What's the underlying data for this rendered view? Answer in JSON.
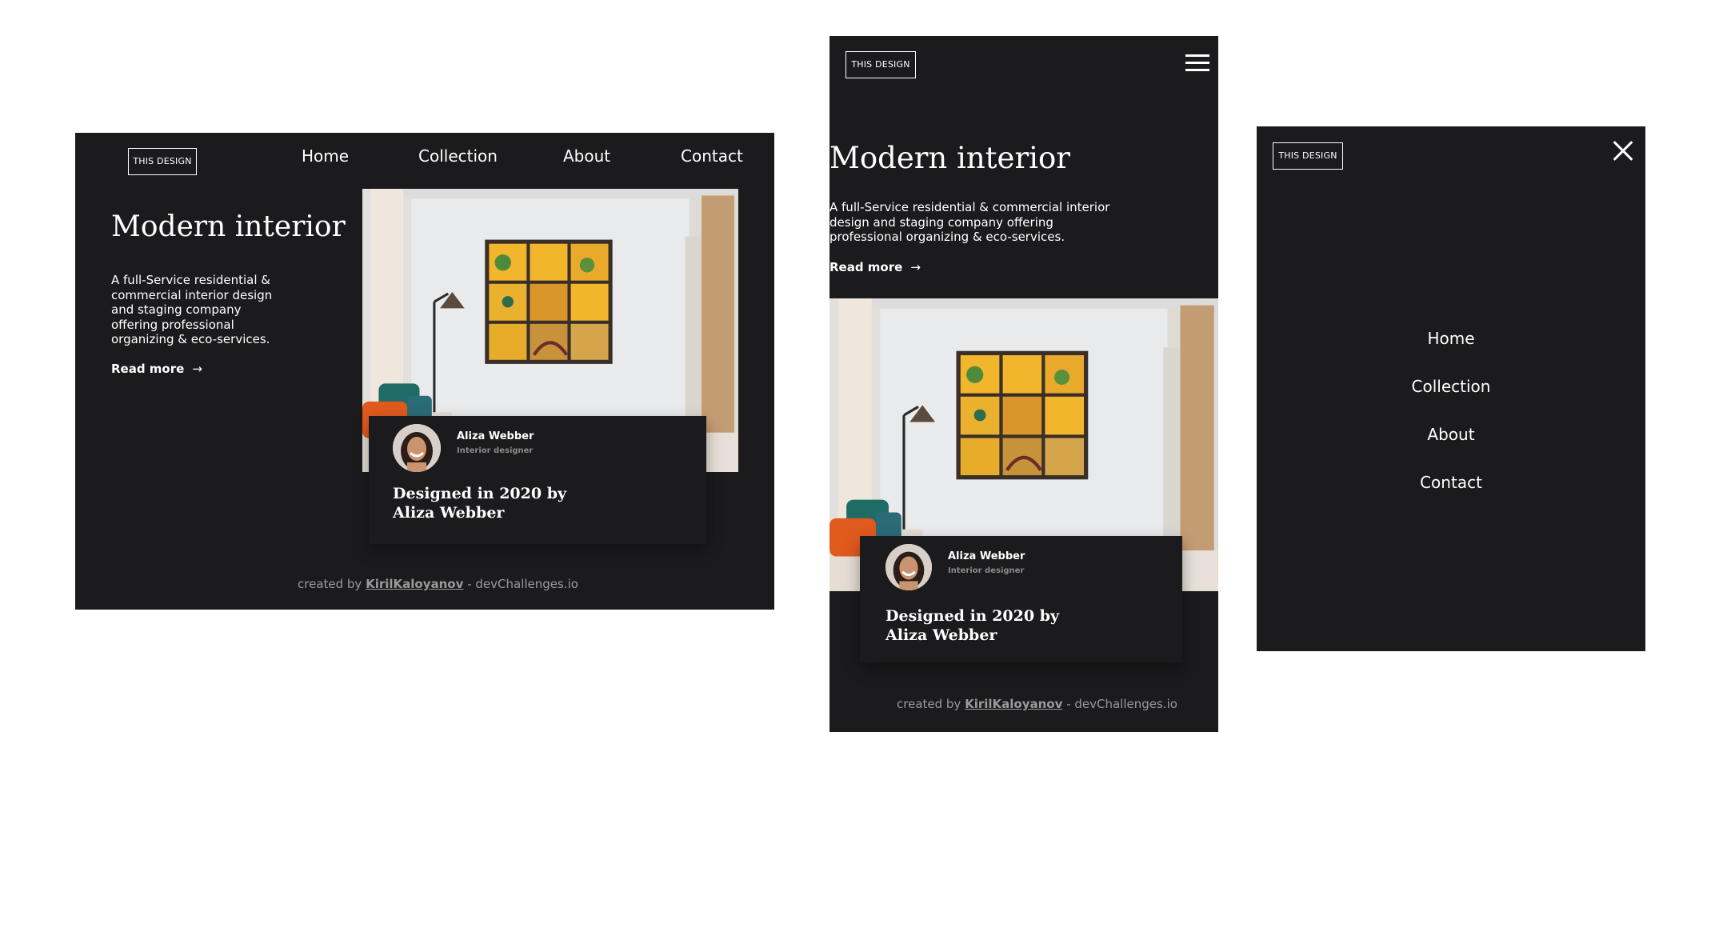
{
  "brand": {
    "logo": "THIS DESIGN"
  },
  "nav": {
    "items": [
      "Home",
      "Collection",
      "About",
      "Contact"
    ]
  },
  "hero": {
    "title": "Modern interior",
    "description": "A full-Service residential & commercial interior design and staging company offering professional organizing & eco-services.",
    "read_more": "Read more",
    "arrow": "→"
  },
  "card": {
    "name": "Aliza Webber",
    "role": "Interior designer",
    "title": "Designed in 2020 by Aliza Webber"
  },
  "footer": {
    "prefix": "created by",
    "author": "KirilKaloyanov",
    "suffix": "- devChallenges.io"
  },
  "icons": {
    "menu": "hamburger-menu-icon",
    "close": "close-icon",
    "arrow": "arrow-right-icon"
  },
  "colors": {
    "background": "#1b1b1d",
    "text": "#ffffff",
    "muted": "#8b8b8b",
    "accent_yellow": "#f1b62c"
  }
}
